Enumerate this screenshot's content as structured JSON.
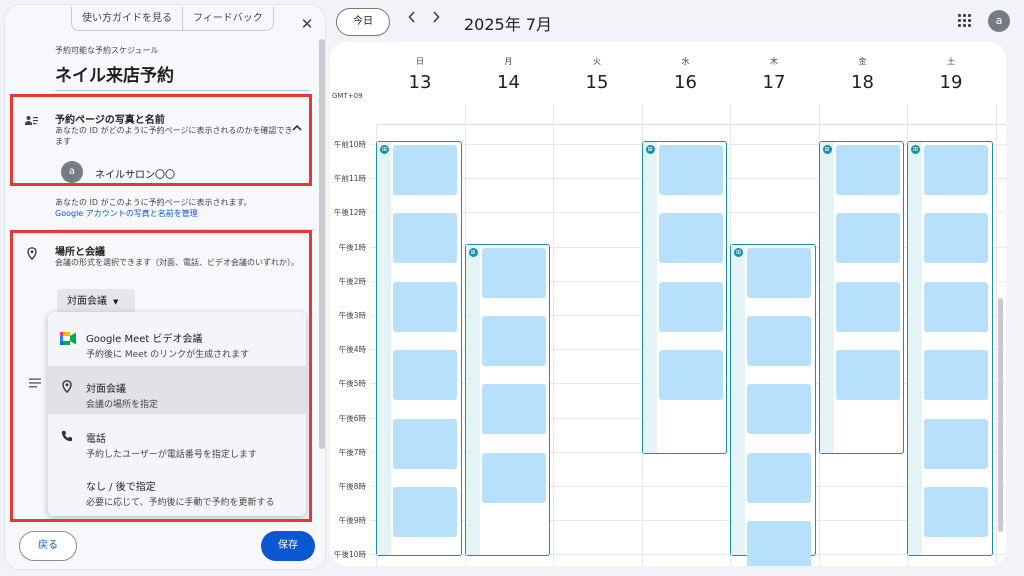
{
  "panel": {
    "guide_label": "使い方ガイドを見る",
    "feedback_label": "フィードバック",
    "close_symbol": "✕",
    "schedule_label": "予約可能な予約スケジュール",
    "schedule_title": "ネイル来店予約",
    "photo_section": {
      "title": "予約ページの写真と名前",
      "description": "あなたの ID がどのように予約ページに表示されるのかを確認できます",
      "avatar_letter": "a",
      "display_name": "ネイルサロン〇〇",
      "note": "あなたの ID がこのように予約ページに表示されます。",
      "manage_link": "Google アカウントの写真と名前を管理"
    },
    "location_section": {
      "title": "場所と会議",
      "description": "会議の形式を選択できます（対面、電話、ビデオ会議のいずれか）。",
      "selected_value": "対面会議"
    },
    "menu_items": [
      {
        "label": "Google Meet ビデオ会議",
        "sub": "予約後に Meet のリンクが生成されます",
        "icon": "meet-icon"
      },
      {
        "label": "対面会議",
        "sub": "会議の場所を指定",
        "icon": "location-pin-icon"
      },
      {
        "label": "電話",
        "sub": "予約したユーザーが電話番号を指定します",
        "icon": "phone-icon"
      },
      {
        "label": "なし / 後で指定",
        "sub": "必要に応じて、予約後に手動で予約を更新する",
        "icon": ""
      }
    ],
    "back_label": "戻る",
    "save_label": "保存"
  },
  "header": {
    "today_label": "今日",
    "month_title": "2025年 7月",
    "account_letter": "a"
  },
  "calendar": {
    "timezone": "GMT+09",
    "days": [
      {
        "dow": "日",
        "date": "13"
      },
      {
        "dow": "月",
        "date": "14"
      },
      {
        "dow": "火",
        "date": "15"
      },
      {
        "dow": "水",
        "date": "16"
      },
      {
        "dow": "木",
        "date": "17"
      },
      {
        "dow": "金",
        "date": "18"
      },
      {
        "dow": "土",
        "date": "19"
      }
    ],
    "hours": [
      "午前10時",
      "午前11時",
      "午後12時",
      "午後1時",
      "午後2時",
      "午後3時",
      "午後4時",
      "午後5時",
      "午後6時",
      "午後7時",
      "午後8時",
      "午後9時",
      "午後10時"
    ],
    "availability": [
      {
        "day": "13",
        "start": "午前10時",
        "end": "午後10時",
        "slots": 6
      },
      {
        "day": "14",
        "start": "午後1時",
        "end": "午後10時",
        "slots": 4
      },
      {
        "day": "16",
        "start": "午前10時",
        "end": "午後7時",
        "slots": 4
      },
      {
        "day": "17",
        "start": "午後1時",
        "end": "午後10時",
        "slots": 5
      },
      {
        "day": "18",
        "start": "午前10時",
        "end": "午後7時",
        "slots": 4
      },
      {
        "day": "19",
        "start": "午前10時",
        "end": "午後10時",
        "slots": 6
      }
    ],
    "accent_color": "#1c8fa5",
    "slot_color": "#b6e0fb"
  }
}
